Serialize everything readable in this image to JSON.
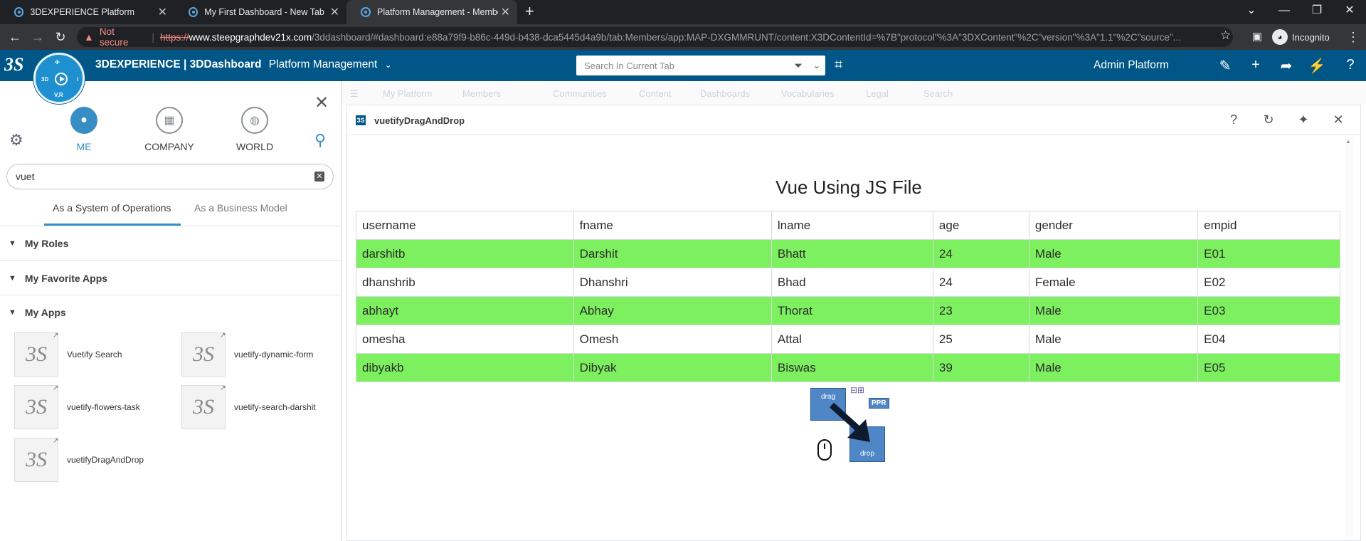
{
  "browser": {
    "tabs": [
      {
        "title": "3DEXPERIENCE Platform"
      },
      {
        "title": "My First Dashboard - New Tab"
      },
      {
        "title": "Platform Management - Member"
      }
    ],
    "security_label": "Not secure",
    "url_scheme": "https://",
    "url_host": "www.steepgraphdev21x.com",
    "url_path": "/3ddashboard/#dashboard:e88a79f9-b86c-449d-b438-dca5445d4a9b/tab:Members/app:MAP-DXGMMRUNT/content:X3DContentId=%7B\"protocol\"%3A\"3DXContent\"%2C\"version\"%3A\"1.1\"%2C\"source\"...",
    "profile_label": "Incognito"
  },
  "header": {
    "brand_bold": "3DEXPERIENCE | 3DDashboard",
    "brand_app": "Platform Management",
    "search_placeholder": "Search In Current Tab",
    "user_label": "Admin Platform",
    "compass_label": "V,R",
    "compass_3d": "3D"
  },
  "panel": {
    "scopes": [
      {
        "label": "ME",
        "active": true
      },
      {
        "label": "COMPANY",
        "active": false
      },
      {
        "label": "WORLD",
        "active": false
      }
    ],
    "search_value": "vuet",
    "tabs": [
      {
        "label": "As a System of Operations",
        "active": true
      },
      {
        "label": "As a Business Model",
        "active": false
      }
    ],
    "sections": [
      {
        "label": "My Roles"
      },
      {
        "label": "My Favorite Apps"
      },
      {
        "label": "My Apps"
      }
    ],
    "apps": [
      {
        "name": "Vuetify Search"
      },
      {
        "name": "vuetify-dynamic-form"
      },
      {
        "name": "vuetify-flowers-task"
      },
      {
        "name": "vuetify-search-darshit"
      },
      {
        "name": "vuetifyDragAndDrop"
      }
    ]
  },
  "background_tabs": [
    "My Platform",
    "Members",
    "Communities",
    "Content",
    "Dashboards",
    "Vocabularies",
    "Legal",
    "Search"
  ],
  "widget": {
    "title": "vuetifyDragAndDrop",
    "heading": "Vue Using JS File",
    "columns": [
      "username",
      "fname",
      "lname",
      "age",
      "gender",
      "empid"
    ],
    "rows": [
      [
        "darshitb",
        "Darshit",
        "Bhatt",
        "24",
        "Male",
        "E01"
      ],
      [
        "dhanshrib",
        "Dhanshri",
        "Bhad",
        "24",
        "Female",
        "E02"
      ],
      [
        "abhayt",
        "Abhay",
        "Thorat",
        "23",
        "Male",
        "E03"
      ],
      [
        "omesha",
        "Omesh",
        "Attal",
        "25",
        "Male",
        "E04"
      ],
      [
        "dibyakb",
        "Dibyak",
        "Biswas",
        "39",
        "Male",
        "E05"
      ]
    ],
    "highlight_color": "#7cf05f",
    "dnd": {
      "drag": "drag",
      "drop": "drop",
      "badge": "PPR"
    }
  }
}
